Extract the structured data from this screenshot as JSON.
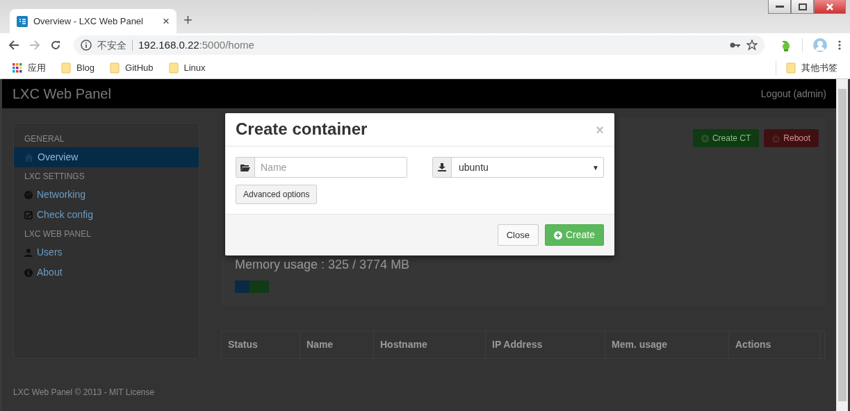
{
  "browser": {
    "tab": {
      "title": "Overview - LXC Web Panel",
      "close": "×"
    },
    "new_tab": "+",
    "address": {
      "security": "不安全",
      "host": "192.168.0.22",
      "path": ":5000/home"
    },
    "bookmarks": [
      {
        "kind": "apps",
        "label": "应用"
      },
      {
        "kind": "folder",
        "label": "Blog"
      },
      {
        "kind": "folder",
        "label": "GitHub"
      },
      {
        "kind": "folder",
        "label": "Linux"
      }
    ],
    "other_bookmarks": "其他书签"
  },
  "navbar": {
    "brand": "LXC Web Panel",
    "logout": "Logout (admin)"
  },
  "sidebar": [
    {
      "kind": "header",
      "label": "GENERAL"
    },
    {
      "kind": "item",
      "label": "Overview",
      "selected": true
    },
    {
      "kind": "header",
      "label": "LXC SETTINGS"
    },
    {
      "kind": "item",
      "label": "Networking",
      "selected": false
    },
    {
      "kind": "item",
      "label": "Check config",
      "selected": false
    },
    {
      "kind": "header",
      "label": "LXC WEB PANEL"
    },
    {
      "kind": "item",
      "label": "Users",
      "selected": false
    },
    {
      "kind": "item",
      "label": "About",
      "selected": false
    }
  ],
  "actions": [
    {
      "kind": "success",
      "label": "Create CT"
    },
    {
      "kind": "danger",
      "label": "Reboot"
    }
  ],
  "memory": {
    "label": "Memory usage : 325 / 3774 MB",
    "segments": [
      {
        "kind": "used",
        "level": 0.025
      },
      {
        "kind": "cached",
        "level": 0.034
      }
    ]
  },
  "table": {
    "columns": [
      "Status",
      "Name",
      "Hostname",
      "IP Address",
      "Mem. usage",
      "Actions"
    ]
  },
  "footer": "LXC Web Panel © 2013 - MIT License",
  "modal": {
    "title": "Create container",
    "close": "×",
    "name_field": {
      "placeholder": "Name"
    },
    "template_select": {
      "value": "ubuntu",
      "caret": "▼"
    },
    "advanced": "Advanced options",
    "buttons": [
      {
        "kind": "default",
        "label": "Close"
      },
      {
        "kind": "primary",
        "label": "Create"
      }
    ]
  }
}
